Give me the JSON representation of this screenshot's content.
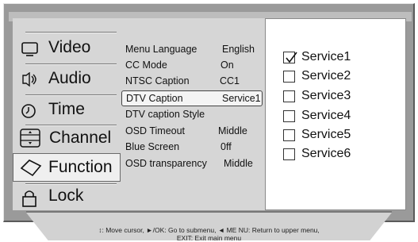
{
  "nav": {
    "items": [
      {
        "label": "Video",
        "icon": "tv-icon"
      },
      {
        "label": "Audio",
        "icon": "speaker-icon"
      },
      {
        "label": "Time",
        "icon": "clock-icon"
      },
      {
        "label": "Channel",
        "icon": "channel-icon"
      },
      {
        "label": "Function",
        "icon": "function-icon",
        "selected": true
      },
      {
        "label": "Lock",
        "icon": "lock-icon"
      }
    ]
  },
  "options": [
    {
      "label": "Menu Language",
      "value": "English"
    },
    {
      "label": "CC Mode",
      "value": "On"
    },
    {
      "label": "NTSC Caption",
      "value": "CC1"
    },
    {
      "label": "DTV Caption",
      "value": "Service1",
      "selected": true
    },
    {
      "label": "DTV caption Style",
      "value": ""
    },
    {
      "label": "OSD Timeout",
      "value": "Middle"
    },
    {
      "label": "Blue Screen",
      "value": "0ff"
    },
    {
      "label": "OSD transparency",
      "value": "Middle"
    }
  ],
  "services": [
    {
      "label": "Service1",
      "checked": true
    },
    {
      "label": "Service2",
      "checked": false
    },
    {
      "label": "Service3",
      "checked": false
    },
    {
      "label": "Service4",
      "checked": false
    },
    {
      "label": "Service5",
      "checked": false
    },
    {
      "label": "Service6",
      "checked": false
    }
  ],
  "help": {
    "line1": "↕: Move cursor, ►/OK: Go to submenu, ◄ ME NU: Return to upper menu,",
    "line2": "EXIT: Exit main menu"
  }
}
